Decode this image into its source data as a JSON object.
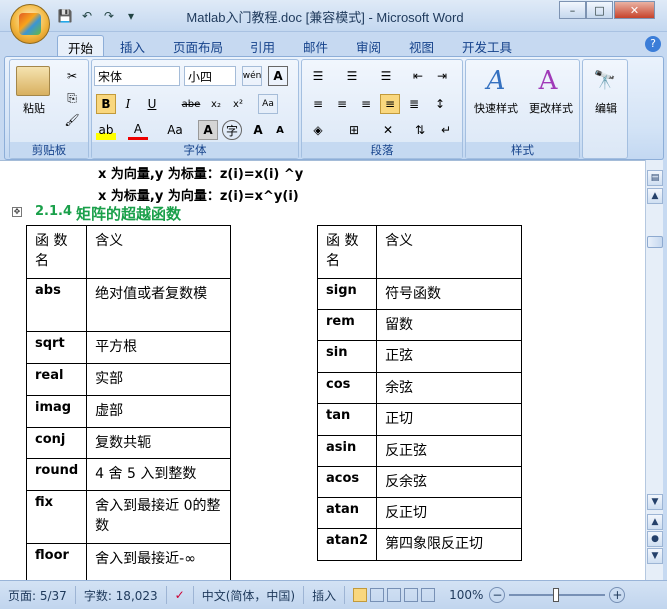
{
  "window": {
    "title": "Matlab入门教程.doc [兼容模式] - Microsoft Word",
    "min": "–",
    "max": "□",
    "close": "✕"
  },
  "qat": {
    "save": "💾",
    "undo": "↶",
    "redo": "↷",
    "custom": "▾"
  },
  "tabs": [
    "开始",
    "插入",
    "页面布局",
    "引用",
    "邮件",
    "审阅",
    "视图",
    "开发工具"
  ],
  "ribbon": {
    "clipboard": {
      "label": "剪贴板",
      "paste": "粘贴"
    },
    "font": {
      "label": "字体",
      "family": "宋体",
      "size": "小四",
      "wen": "wén",
      "bold": "B",
      "italic": "I",
      "underline": "U",
      "strike": "abe",
      "sub": "x₂",
      "sup": "x²",
      "aa": "Aa",
      "grow": "A",
      "shrink": "A",
      "clear": "A"
    },
    "paragraph": {
      "label": "段落"
    },
    "styles": {
      "label": "样式",
      "quick": "快速样式",
      "change": "更改样式"
    },
    "edit": {
      "label": "编辑"
    }
  },
  "document": {
    "line1": "x 为向量,y 为标量：z(i)=x(i) ^y",
    "line2": "x 为标量,y 为向量：z(i)=x^y(i)",
    "section_num": "2.1.4",
    "section_title": "矩阵的超越函数",
    "table_left": {
      "header": [
        "函 数 名",
        "含义"
      ],
      "rows": [
        [
          "abs",
          "绝对值或者复数模"
        ],
        [
          "sqrt",
          "平方根"
        ],
        [
          "real",
          "实部"
        ],
        [
          "imag",
          "虚部"
        ],
        [
          "conj",
          "复数共轭"
        ],
        [
          "round",
          "4 舍 5 入到整数"
        ],
        [
          "fix",
          "舍入到最接近 0的整数"
        ],
        [
          "floor",
          "舍入到最接近-∞"
        ]
      ]
    },
    "table_right": {
      "header": [
        "函 数 名",
        "含义"
      ],
      "rows": [
        [
          "sign",
          "符号函数"
        ],
        [
          "rem",
          "留数"
        ],
        [
          "sin",
          "正弦"
        ],
        [
          "cos",
          "余弦"
        ],
        [
          "tan",
          "正切"
        ],
        [
          "asin",
          "反正弦"
        ],
        [
          "acos",
          "反余弦"
        ],
        [
          "atan",
          "反正切"
        ],
        [
          "atan2",
          "第四象限反正切"
        ]
      ]
    }
  },
  "status": {
    "page": "页面: 5/37",
    "words": "字数: 18,023",
    "lang": "中文(简体，中国)",
    "mode": "插入",
    "zoom": "100%",
    "zoom_minus": "−",
    "zoom_plus": "+"
  }
}
